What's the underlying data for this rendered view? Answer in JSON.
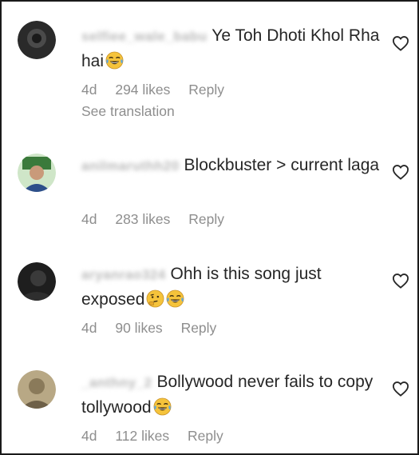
{
  "comments": [
    {
      "username": "selfiee_wale_babu",
      "text": "Ye Toh Dhoti Khol Rha hai",
      "emojis": [
        "face-with-tears-of-joy"
      ],
      "time": "4d",
      "likes": "294 likes",
      "reply": "Reply",
      "see_translation": "See translation",
      "avatar_color": "#2a2a2a"
    },
    {
      "username": "anilmaruthh20",
      "text": "Blockbuster > current laga",
      "emojis": [],
      "time": "4d",
      "likes": "283 likes",
      "reply": "Reply",
      "avatar_color": "#3b7a3b"
    },
    {
      "username": "aryanrao324",
      "text": "Ohh is this song just exposed",
      "emojis": [
        "thinking-face",
        "face-with-tears-of-joy"
      ],
      "time": "4d",
      "likes": "90 likes",
      "reply": "Reply",
      "avatar_color": "#1e1e1e"
    },
    {
      "username": "_anthny_2",
      "text": "Bollywood never fails to copy tollywood",
      "emojis": [
        "face-with-tears-of-joy"
      ],
      "time": "4d",
      "likes": "112 likes",
      "reply": "Reply",
      "avatar_color": "#9a8a68"
    }
  ],
  "colors": {
    "text": "#262626",
    "meta": "#8e8e8e",
    "emoji_yellow": "#f5c33b",
    "emoji_tear": "#5aa7e6"
  },
  "icons": {
    "like": "heart-outline-icon"
  }
}
